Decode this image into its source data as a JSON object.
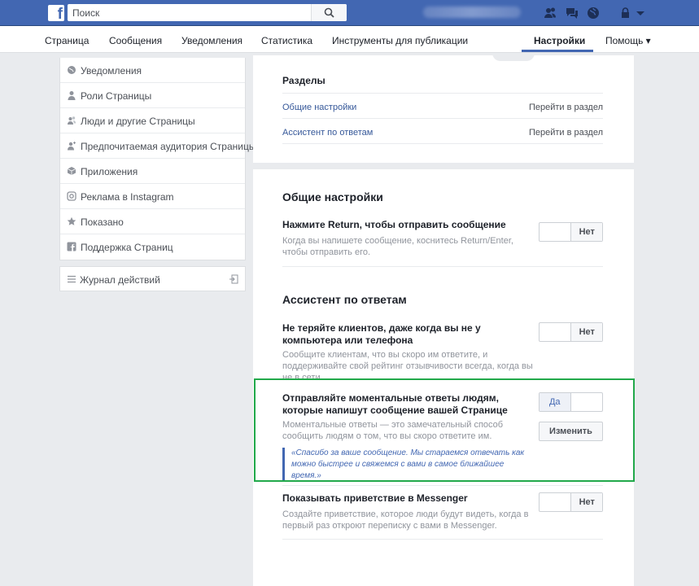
{
  "topbar": {
    "logo": "f",
    "search_placeholder": "Поиск",
    "icons": [
      "search-icon",
      "friends-icon",
      "messages-icon",
      "globe-icon",
      "lock-icon",
      "chevron-down-icon"
    ]
  },
  "nav": {
    "items": [
      "Страница",
      "Сообщения",
      "Уведомления",
      "Статистика",
      "Инструменты для публикации"
    ],
    "settings": "Настройки",
    "help": "Помощь ▾"
  },
  "sidebar": {
    "items": [
      {
        "label": "Уведомления",
        "icon": "globe-icon"
      },
      {
        "label": "Роли Страницы",
        "icon": "person-icon"
      },
      {
        "label": "Люди и другие Страницы",
        "icon": "people-icon"
      },
      {
        "label": "Предпочитаемая аудитория Страницы",
        "icon": "audience-icon"
      },
      {
        "label": "Приложения",
        "icon": "cube-icon"
      },
      {
        "label": "Реклама в Instagram",
        "icon": "instagram-icon"
      },
      {
        "label": "Показано",
        "icon": "star-icon"
      },
      {
        "label": "Поддержка Страниц",
        "icon": "facebook-icon"
      }
    ],
    "activity_log": "Журнал действий"
  },
  "sections": {
    "heading": "Разделы",
    "links": [
      {
        "title": "Общие настройки",
        "go": "Перейти в раздел"
      },
      {
        "title": "Ассистент по ответам",
        "go": "Перейти в раздел"
      }
    ]
  },
  "general": {
    "heading": "Общие настройки",
    "return_title": "Нажмите Return, чтобы отправить сообщение",
    "return_desc": "Когда вы напишете сообщение, коснитесь Return/Enter, чтобы отправить его.",
    "return_toggle": "Нет"
  },
  "assistant": {
    "heading": "Ассистент по ответам",
    "away_title": "Не теряйте клиентов, даже когда вы не у компьютера или телефона",
    "away_desc": "Сообщите клиентам, что вы скоро им ответите, и поддерживайте свой рейтинг отзывчивости всегда, когда вы не в сети.",
    "away_toggle": "Нет",
    "instant_title": "Отправляйте моментальные ответы людям, которые напишут сообщение вашей Странице",
    "instant_desc": "Моментальные ответы — это замечательный способ сообщить людям о том, что вы скоро ответите им.",
    "instant_toggle": "Да",
    "instant_edit": "Изменить",
    "instant_quote": "«Спасибо за ваше сообщение. Мы стараемся отвечать как можно быстрее и свяжемся с вами в самое ближайшее время.»",
    "greeting_title": "Показывать приветствие в Messenger",
    "greeting_desc": "Создайте приветствие, которое люди будут видеть, когда в первый раз откроют переписку с вами в Messenger.",
    "greeting_toggle": "Нет"
  },
  "colors": {
    "brand": "#4267b2",
    "highlight": "#22a94b"
  }
}
